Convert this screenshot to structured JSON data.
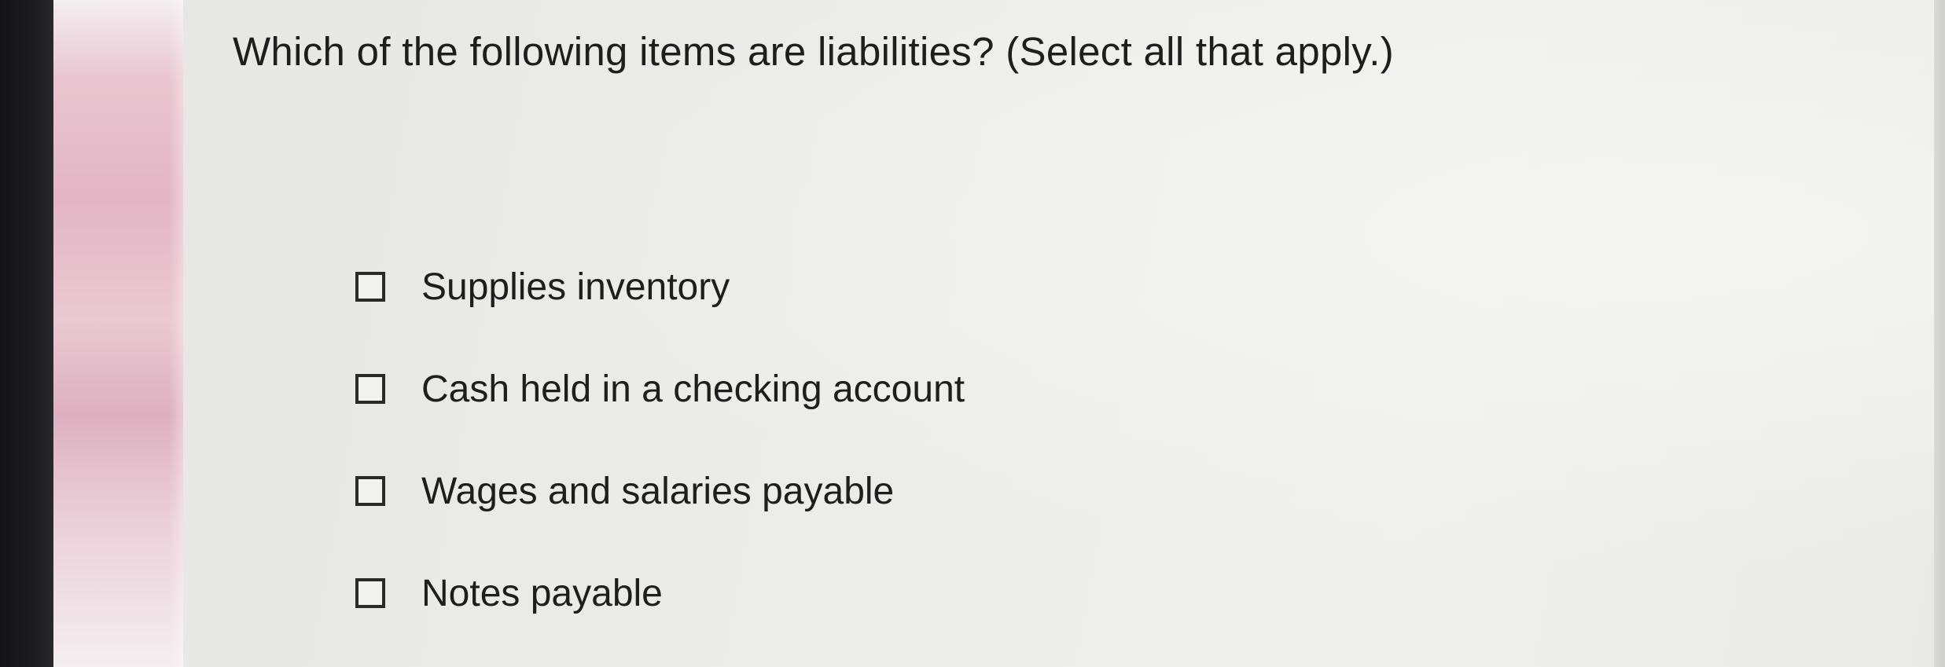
{
  "question": {
    "text": "Which of the following items are liabilities? (Select all that apply.)"
  },
  "options": [
    {
      "label": "Supplies inventory",
      "checked": false
    },
    {
      "label": "Cash held in a checking account",
      "checked": false
    },
    {
      "label": "Wages and salaries payable",
      "checked": false
    },
    {
      "label": "Notes payable",
      "checked": false
    }
  ]
}
